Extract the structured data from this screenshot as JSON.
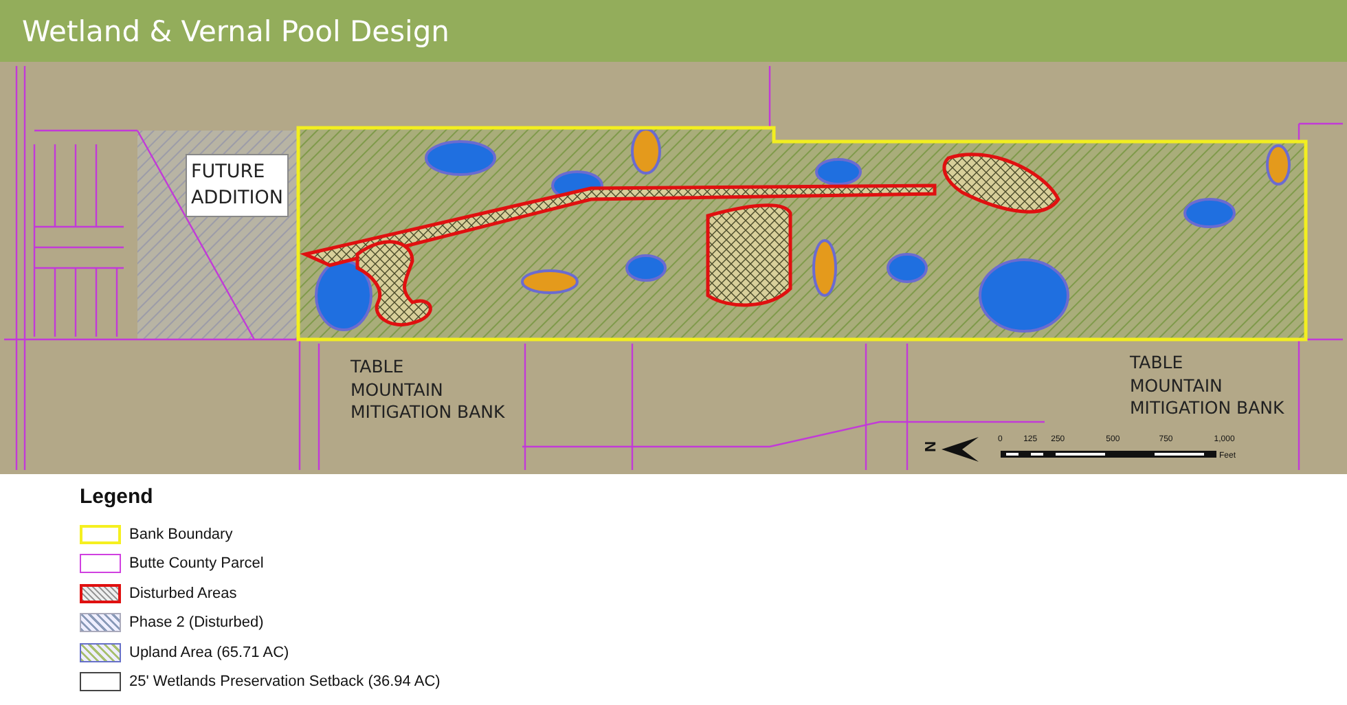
{
  "header": {
    "title": "Wetland & Vernal Pool Design"
  },
  "map": {
    "labels": [
      {
        "kind": "boxed",
        "lines": [
          "FUTURE",
          "ADDITION"
        ]
      },
      {
        "kind": "plain",
        "lines": [
          "TABLE",
          "MOUNTAIN",
          "MITIGATION BANK"
        ]
      },
      {
        "kind": "plain",
        "lines": [
          "TABLE",
          "MOUNTAIN",
          "MITIGATION BANK"
        ]
      }
    ],
    "north_label": "N",
    "scale": {
      "ticks": [
        "0",
        "125",
        "250",
        "500",
        "750",
        "1,000"
      ],
      "unit": "Feet"
    }
  },
  "legend": {
    "title": "Legend",
    "items": [
      {
        "kind": "boundary",
        "label": "Bank Boundary"
      },
      {
        "kind": "parcel",
        "label": "Butte County Parcel"
      },
      {
        "kind": "disturbed",
        "label": "Disturbed Areas"
      },
      {
        "kind": "phase2",
        "label": "Phase 2 (Disturbed)"
      },
      {
        "kind": "upland",
        "label": "Upland Area (65.71 AC)"
      },
      {
        "kind": "setback",
        "label": "25' Wetlands Preservation Setback (36.94 AC)"
      }
    ]
  }
}
